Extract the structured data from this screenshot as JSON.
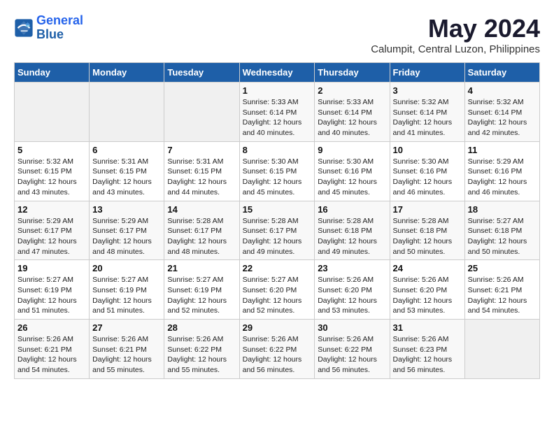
{
  "header": {
    "logo_line1": "General",
    "logo_line2": "Blue",
    "month_title": "May 2024",
    "location": "Calumpit, Central Luzon, Philippines"
  },
  "weekdays": [
    "Sunday",
    "Monday",
    "Tuesday",
    "Wednesday",
    "Thursday",
    "Friday",
    "Saturday"
  ],
  "weeks": [
    [
      {
        "day": "",
        "sunrise": "",
        "sunset": "",
        "daylight": ""
      },
      {
        "day": "",
        "sunrise": "",
        "sunset": "",
        "daylight": ""
      },
      {
        "day": "",
        "sunrise": "",
        "sunset": "",
        "daylight": ""
      },
      {
        "day": "1",
        "sunrise": "Sunrise: 5:33 AM",
        "sunset": "Sunset: 6:14 PM",
        "daylight": "Daylight: 12 hours and 40 minutes."
      },
      {
        "day": "2",
        "sunrise": "Sunrise: 5:33 AM",
        "sunset": "Sunset: 6:14 PM",
        "daylight": "Daylight: 12 hours and 40 minutes."
      },
      {
        "day": "3",
        "sunrise": "Sunrise: 5:32 AM",
        "sunset": "Sunset: 6:14 PM",
        "daylight": "Daylight: 12 hours and 41 minutes."
      },
      {
        "day": "4",
        "sunrise": "Sunrise: 5:32 AM",
        "sunset": "Sunset: 6:14 PM",
        "daylight": "Daylight: 12 hours and 42 minutes."
      }
    ],
    [
      {
        "day": "5",
        "sunrise": "Sunrise: 5:32 AM",
        "sunset": "Sunset: 6:15 PM",
        "daylight": "Daylight: 12 hours and 43 minutes."
      },
      {
        "day": "6",
        "sunrise": "Sunrise: 5:31 AM",
        "sunset": "Sunset: 6:15 PM",
        "daylight": "Daylight: 12 hours and 43 minutes."
      },
      {
        "day": "7",
        "sunrise": "Sunrise: 5:31 AM",
        "sunset": "Sunset: 6:15 PM",
        "daylight": "Daylight: 12 hours and 44 minutes."
      },
      {
        "day": "8",
        "sunrise": "Sunrise: 5:30 AM",
        "sunset": "Sunset: 6:15 PM",
        "daylight": "Daylight: 12 hours and 45 minutes."
      },
      {
        "day": "9",
        "sunrise": "Sunrise: 5:30 AM",
        "sunset": "Sunset: 6:16 PM",
        "daylight": "Daylight: 12 hours and 45 minutes."
      },
      {
        "day": "10",
        "sunrise": "Sunrise: 5:30 AM",
        "sunset": "Sunset: 6:16 PM",
        "daylight": "Daylight: 12 hours and 46 minutes."
      },
      {
        "day": "11",
        "sunrise": "Sunrise: 5:29 AM",
        "sunset": "Sunset: 6:16 PM",
        "daylight": "Daylight: 12 hours and 46 minutes."
      }
    ],
    [
      {
        "day": "12",
        "sunrise": "Sunrise: 5:29 AM",
        "sunset": "Sunset: 6:17 PM",
        "daylight": "Daylight: 12 hours and 47 minutes."
      },
      {
        "day": "13",
        "sunrise": "Sunrise: 5:29 AM",
        "sunset": "Sunset: 6:17 PM",
        "daylight": "Daylight: 12 hours and 48 minutes."
      },
      {
        "day": "14",
        "sunrise": "Sunrise: 5:28 AM",
        "sunset": "Sunset: 6:17 PM",
        "daylight": "Daylight: 12 hours and 48 minutes."
      },
      {
        "day": "15",
        "sunrise": "Sunrise: 5:28 AM",
        "sunset": "Sunset: 6:17 PM",
        "daylight": "Daylight: 12 hours and 49 minutes."
      },
      {
        "day": "16",
        "sunrise": "Sunrise: 5:28 AM",
        "sunset": "Sunset: 6:18 PM",
        "daylight": "Daylight: 12 hours and 49 minutes."
      },
      {
        "day": "17",
        "sunrise": "Sunrise: 5:28 AM",
        "sunset": "Sunset: 6:18 PM",
        "daylight": "Daylight: 12 hours and 50 minutes."
      },
      {
        "day": "18",
        "sunrise": "Sunrise: 5:27 AM",
        "sunset": "Sunset: 6:18 PM",
        "daylight": "Daylight: 12 hours and 50 minutes."
      }
    ],
    [
      {
        "day": "19",
        "sunrise": "Sunrise: 5:27 AM",
        "sunset": "Sunset: 6:19 PM",
        "daylight": "Daylight: 12 hours and 51 minutes."
      },
      {
        "day": "20",
        "sunrise": "Sunrise: 5:27 AM",
        "sunset": "Sunset: 6:19 PM",
        "daylight": "Daylight: 12 hours and 51 minutes."
      },
      {
        "day": "21",
        "sunrise": "Sunrise: 5:27 AM",
        "sunset": "Sunset: 6:19 PM",
        "daylight": "Daylight: 12 hours and 52 minutes."
      },
      {
        "day": "22",
        "sunrise": "Sunrise: 5:27 AM",
        "sunset": "Sunset: 6:20 PM",
        "daylight": "Daylight: 12 hours and 52 minutes."
      },
      {
        "day": "23",
        "sunrise": "Sunrise: 5:26 AM",
        "sunset": "Sunset: 6:20 PM",
        "daylight": "Daylight: 12 hours and 53 minutes."
      },
      {
        "day": "24",
        "sunrise": "Sunrise: 5:26 AM",
        "sunset": "Sunset: 6:20 PM",
        "daylight": "Daylight: 12 hours and 53 minutes."
      },
      {
        "day": "25",
        "sunrise": "Sunrise: 5:26 AM",
        "sunset": "Sunset: 6:21 PM",
        "daylight": "Daylight: 12 hours and 54 minutes."
      }
    ],
    [
      {
        "day": "26",
        "sunrise": "Sunrise: 5:26 AM",
        "sunset": "Sunset: 6:21 PM",
        "daylight": "Daylight: 12 hours and 54 minutes."
      },
      {
        "day": "27",
        "sunrise": "Sunrise: 5:26 AM",
        "sunset": "Sunset: 6:21 PM",
        "daylight": "Daylight: 12 hours and 55 minutes."
      },
      {
        "day": "28",
        "sunrise": "Sunrise: 5:26 AM",
        "sunset": "Sunset: 6:22 PM",
        "daylight": "Daylight: 12 hours and 55 minutes."
      },
      {
        "day": "29",
        "sunrise": "Sunrise: 5:26 AM",
        "sunset": "Sunset: 6:22 PM",
        "daylight": "Daylight: 12 hours and 56 minutes."
      },
      {
        "day": "30",
        "sunrise": "Sunrise: 5:26 AM",
        "sunset": "Sunset: 6:22 PM",
        "daylight": "Daylight: 12 hours and 56 minutes."
      },
      {
        "day": "31",
        "sunrise": "Sunrise: 5:26 AM",
        "sunset": "Sunset: 6:23 PM",
        "daylight": "Daylight: 12 hours and 56 minutes."
      },
      {
        "day": "",
        "sunrise": "",
        "sunset": "",
        "daylight": ""
      }
    ]
  ]
}
